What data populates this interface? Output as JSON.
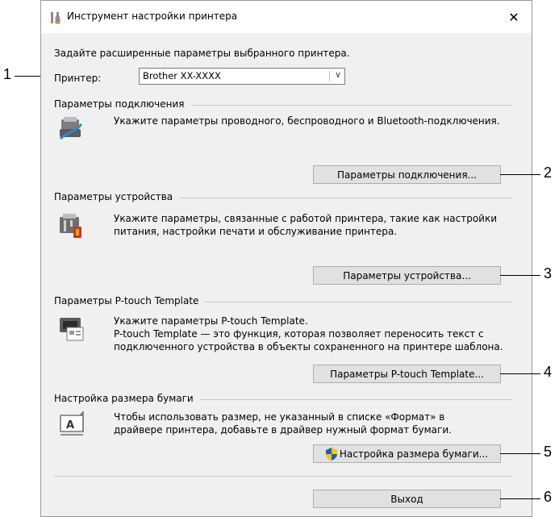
{
  "window": {
    "title": "Инструмент настройки принтера",
    "close_glyph": "✕",
    "icon": "printer-tools-icon"
  },
  "intro": "Задайте расширенные параметры выбранного принтера.",
  "printer": {
    "label": "Принтер:",
    "selected": "Brother XX-XXXX",
    "dropdown_glyph": "∨"
  },
  "sections": {
    "connection": {
      "title": "Параметры подключения",
      "icon": "network-printer-icon",
      "desc": [
        "Укажите параметры проводного, беспроводного и Bluetooth-подключения."
      ],
      "button": "Параметры подключения..."
    },
    "device": {
      "title": "Параметры устройства",
      "icon": "device-settings-icon",
      "desc": [
        "Укажите параметры, связанные с работой принтера, такие как настройки",
        "питания, настройки печати и обслуживание принтера."
      ],
      "button": "Параметры устройства..."
    },
    "template": {
      "title": "Параметры P-touch Template",
      "icon": "template-icon",
      "desc": [
        "Укажите параметры P-touch Template.",
        "P-touch Template — это функция, которая позволяет переносить текст с",
        "подключенного устройства в объекты сохраненного на принтере шаблона."
      ],
      "button": "Параметры P-touch Template..."
    },
    "paper": {
      "title": "Настройка размера бумаги",
      "icon": "paper-size-icon",
      "desc": [
        "Чтобы использовать размер, не указанный в списке «Формат» в",
        "драйвере принтера, добавьте в драйвер нужный формат бумаги."
      ],
      "button": "Настройка размера бумаги...",
      "button_icon": "uac-shield-icon"
    }
  },
  "exit_button": "Выход",
  "callouts": [
    "1",
    "2",
    "3",
    "4",
    "5",
    "6"
  ],
  "colors": {
    "dialog_bg": "#f0f0f0",
    "button_bg": "#e1e1e1",
    "shield_blue": "#1e5fb4",
    "shield_yellow": "#f5c518"
  }
}
